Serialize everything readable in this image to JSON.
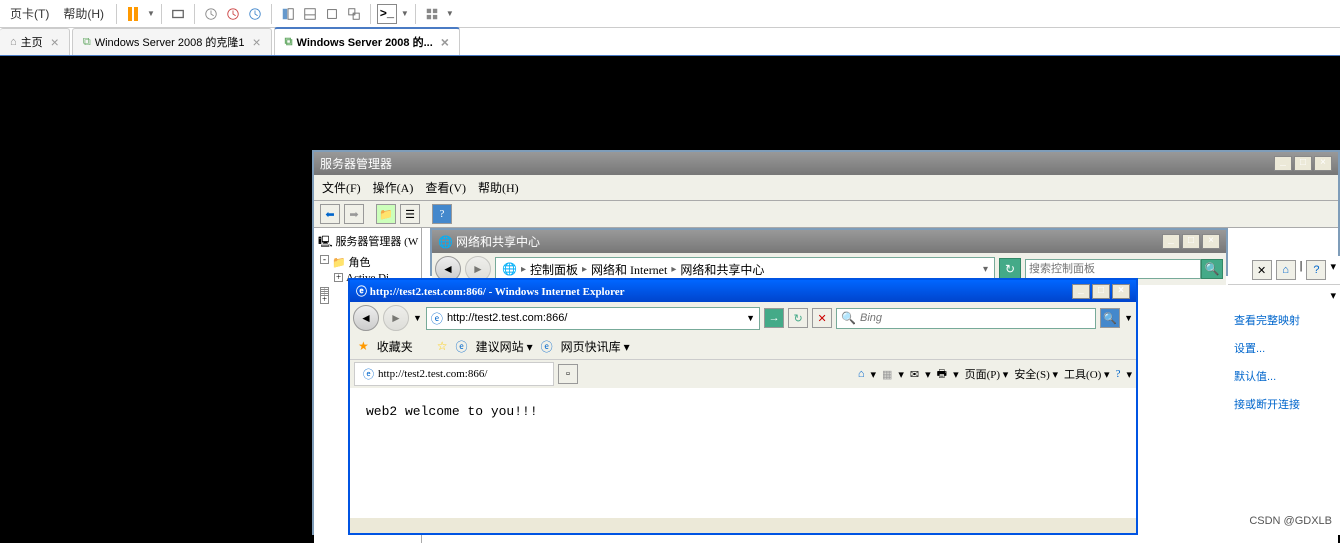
{
  "topMenu": {
    "tab": "页卡(T)",
    "help": "帮助(H)"
  },
  "tabs": {
    "home": "主页",
    "clone1": "Windows Server 2008 的克隆1",
    "clone2": "Windows Server 2008 的..."
  },
  "serverMgr": {
    "title": "服务器管理器",
    "menu": {
      "file": "文件(F)",
      "action": "操作(A)",
      "view": "查看(V)",
      "help": "帮助(H)"
    },
    "tree": {
      "root": "服务器管理器 (W",
      "roles": "角色",
      "activeDir": "Active Di"
    }
  },
  "networkWin": {
    "title": "网络和共享中心",
    "bc1": "控制面板",
    "bc2": "网络和 Internet",
    "bc3": "网络和共享中心",
    "searchPlaceholder": "搜索控制面板"
  },
  "rightPanel": {
    "link1": "查看完整映射",
    "link2": "设置...",
    "link3": "默认值...",
    "link4": "接或断开连接"
  },
  "ie": {
    "title": "http://test2.test.com:866/ - Windows Internet Explorer",
    "url": "http://test2.test.com:866/",
    "searchPlaceholder": "Bing",
    "favLabel": "收藏夹",
    "suggested": "建议网站 ▾",
    "quickInfo": "网页快讯库 ▾",
    "tabUrl": "http://test2.test.com:866/",
    "menu": {
      "page": "页面(P) ▾",
      "safety": "安全(S) ▾",
      "tools": "工具(O) ▾"
    },
    "content": "web2 welcome to you!!!"
  },
  "watermark": "CSDN @GDXLB"
}
